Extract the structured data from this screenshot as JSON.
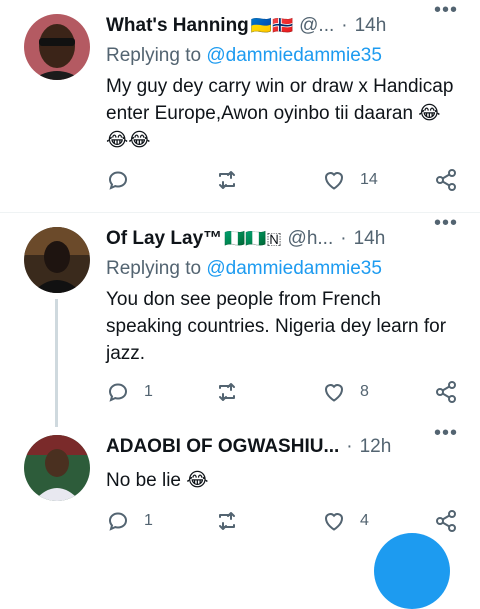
{
  "tweets": [
    {
      "name": "What's Hanning",
      "flags": "🇺🇦🇳🇴",
      "handle": "@...",
      "time": "14h",
      "reply_prefix": "Replying to",
      "reply_to": "@dammiedammie35",
      "text": "My guy dey carry win or draw x Handicap enter Europe,Awon oyinbo tii daaran 😂😂😂",
      "replies": "",
      "retweets": "",
      "likes": "14"
    },
    {
      "name": "Of Lay Lay™",
      "flags": "🇳🇬🇳🇬🇳",
      "handle": "@h...",
      "time": "14h",
      "reply_prefix": "Replying to",
      "reply_to": "@dammiedammie35",
      "text": "You don see people from French speaking countries. Nigeria dey learn for jazz.",
      "replies": "1",
      "retweets": "",
      "likes": "8"
    },
    {
      "name": "ADAOBI OF OGWASHIU...",
      "flags": "",
      "handle": "",
      "time": "12h",
      "reply_prefix": "",
      "reply_to": "",
      "text": "No be lie 😂",
      "replies": "1",
      "retweets": "",
      "likes": "4"
    }
  ],
  "icons": {
    "reply": "reply-icon",
    "retweet": "retweet-icon",
    "like": "heart-icon",
    "share": "share-icon",
    "more": "more-icon"
  },
  "colors": {
    "accent": "#1d9bf0",
    "secondary_text": "#536471",
    "thread_line": "#cfd9de"
  }
}
